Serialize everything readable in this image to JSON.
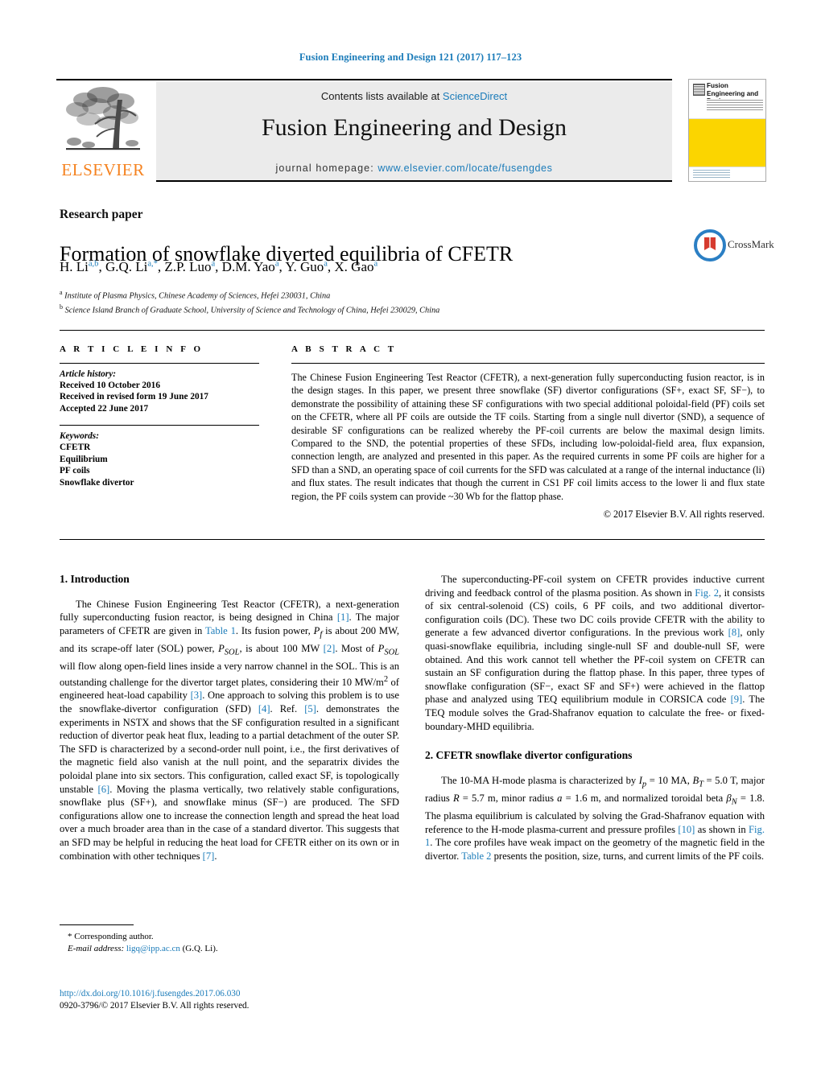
{
  "running_head": "Fusion Engineering and Design 121 (2017) 117–123",
  "masthead": {
    "contents_prefix": "Contents lists available at ",
    "contents_link": "ScienceDirect",
    "journal_title": "Fusion Engineering and Design",
    "homepage_prefix": "journal homepage: ",
    "homepage_link": "www.elsevier.com/locate/fusengdes",
    "publisher_logo_text": "ELSEVIER",
    "cover_title": "Fusion Engineering and Design"
  },
  "article": {
    "type": "Research paper",
    "title": "Formation of snowflake diverted equilibria of CFETR",
    "authors_html": "H. Li<sup>a,b</sup>, G.Q. Li<sup>a,</sup><sup class=\"star\">*</sup>, Z.P. Luo<sup>a</sup>, D.M. Yao<sup>a</sup>, Y. Guo<sup>a</sup>, X. Gao<sup>a</sup>",
    "affiliation_a": "Institute of Plasma Physics, Chinese Academy of Sciences, Hefei 230031, China",
    "affiliation_b": "Science Island Branch of Graduate School, University of Science and Technology of China, Hefei 230029, China",
    "crossmark_label": "CrossMark"
  },
  "article_info": {
    "heading": "A R T I C L E   I N F O",
    "history_heading": "Article history:",
    "history": [
      "Received 10 October 2016",
      "Received in revised form 19 June 2017",
      "Accepted 22 June 2017"
    ],
    "keywords_heading": "Keywords:",
    "keywords": [
      "CFETR",
      "Equilibrium",
      "PF coils",
      "Snowflake divertor"
    ]
  },
  "abstract": {
    "heading": "A B S T R A C T",
    "text": "The Chinese Fusion Engineering Test Reactor (CFETR), a next-generation fully superconducting fusion reactor, is in the design stages. In this paper, we present three snowflake (SF) divertor configurations (SF+, exact SF, SF−), to demonstrate the possibility of attaining these SF configurations with two special additional poloidal-field (PF) coils set on the CFETR, where all PF coils are outside the TF coils. Starting from a single null divertor (SND), a sequence of desirable SF configurations can be realized whereby the PF-coil currents are below the maximal design limits. Compared to the SND, the potential properties of these SFDs, including low-poloidal-field area, flux expansion, connection length, are analyzed and presented in this paper. As the required currents in some PF coils are higher for a SFD than a SND, an operating space of coil currents for the SFD was calculated at a range of the internal inductance (li) and flux states. The result indicates that though the current in CS1 PF coil limits access to the lower li and flux state region, the PF coils system can provide ~30 Wb for the flattop phase.",
    "copyright": "© 2017 Elsevier B.V. All rights reserved."
  },
  "body": {
    "section1_heading": "1.  Introduction",
    "section2_heading": "2.  CFETR snowflake divertor configurations",
    "p1_html": "The Chinese Fusion Engineering Test Reactor (CFETR), a next-generation fully superconducting fusion reactor, is being designed in China <span class=\"ref\">[1]</span>. The major parameters of CFETR are given in <span class=\"ref\">Table 1</span>. Its fusion power, <span class=\"math-i\">P<sub>f</sub></span> is about 200 MW, and its scrape-off later (SOL) power, <span class=\"math-i\">P<sub>SOL</sub></span>, is about 100 MW <span class=\"ref\">[2]</span>. Most of <span class=\"math-i\">P<sub>SOL</sub></span> will flow along open-field lines inside a very narrow channel in the SOL. This is an outstanding challenge for the divertor target plates, considering their 10 MW/m<sup>2</sup> of engineered heat-load capability <span class=\"ref\">[3]</span>. One approach to solving this problem is to use the snowflake-divertor configuration (SFD) <span class=\"ref\">[4]</span>. Ref. <span class=\"ref\">[5]</span>. demonstrates the experiments in NSTX and shows that the SF configuration resulted in a significant reduction of divertor peak heat flux, leading to a partial detachment of the outer SP. The SFD is characterized by a second-order null point, i.e., the first derivatives of the magnetic field also vanish at the null point, and the separatrix divides the poloidal plane into six sectors. This configuration, called exact SF, is topologically unstable <span class=\"ref\">[6]</span>. Moving the plasma vertically, two relatively stable configurations, snowflake plus (SF+), and snowflake minus (SF−) are produced. The SFD configurations allow one to increase the connection length and spread the heat load over a much broader area than in the case of a standard divertor. This suggests that an SFD may be helpful in reducing the heat load for CFETR either on its own or in combination with other techniques <span class=\"ref\">[7]</span>.",
    "p2_html": "The superconducting-PF-coil system on CFETR provides inductive current driving and feedback control of the plasma position. As shown in <span class=\"ref\">Fig. 2</span>, it consists of six central-solenoid (CS) coils, 6 PF coils, and two additional divertor-configuration coils (DC). These two DC coils provide CFETR with the ability to generate a few advanced divertor configurations. In the previous work <span class=\"ref\">[8]</span>, only quasi-snowflake equilibria, including single-null SF and double-null SF, were obtained. And this work cannot tell whether the PF-coil system on CFETR can sustain an SF configuration during the flattop phase. In this paper, three types of snowflake configuration (SF−, exact SF and SF+) were achieved in the flattop phase and analyzed using TEQ equilibrium module in CORSICA code <span class=\"ref\">[9]</span>. The TEQ module solves the Grad-Shafranov equation to calculate the free- or fixed-boundary-MHD equilibria.",
    "p3_html": "The 10-MA H-mode plasma is characterized by <span class=\"math-i\">I<sub>p</sub></span> = 10 MA, <span class=\"math-i\">B<sub>T</sub></span> = 5.0 T, major radius <span class=\"math-i\">R</span> = 5.7 m, minor radius <span class=\"math-i\">a</span> = 1.6 m, and normalized toroidal beta <span class=\"math-i\">β<sub>N</sub></span> = 1.8. The plasma equilibrium is calculated by solving the Grad-Shafranov equation with reference to the H-mode plasma-current and pressure profiles <span class=\"ref\">[10]</span> as shown in <span class=\"ref\">Fig. 1</span>. The core profiles have weak impact on the geometry of the magnetic field in the divertor. <span class=\"ref\">Table 2</span> presents the position, size, turns, and current limits of the PF coils."
  },
  "footer": {
    "corresponding_author": "*  Corresponding author.",
    "email_label": "E-mail address:",
    "email": "ligq@ipp.ac.cn",
    "email_suffix": "(G.Q. Li).",
    "doi": "http://dx.doi.org/10.1016/j.fusengdes.2017.06.030",
    "issn_line": "0920-3796/© 2017 Elsevier B.V. All rights reserved."
  },
  "colors": {
    "link_blue": "#1a7bb9",
    "elsevier_orange": "#f5821f",
    "cover_yellow": "#fbd500"
  }
}
